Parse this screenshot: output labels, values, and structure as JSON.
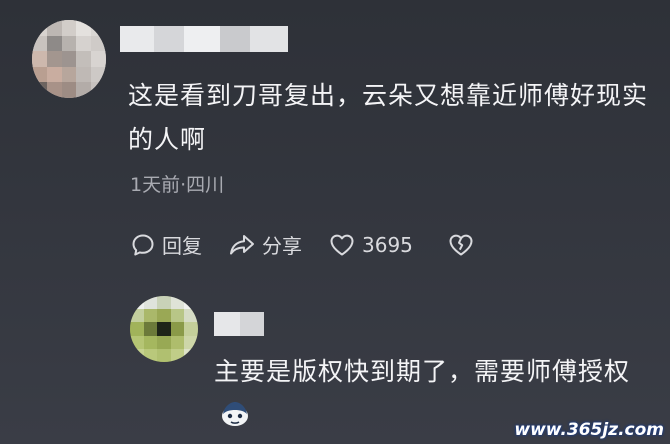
{
  "comment": {
    "text": "这是看到刀哥复出，云朵又想靠近师傅好现实的人啊",
    "meta": "1天前·四川",
    "actions": {
      "reply_label": "回复",
      "share_label": "分享",
      "like_count": "3695"
    }
  },
  "reply": {
    "text": "主要是版权快到期了，需要师傅授权"
  },
  "watermark": "www.365jz.com",
  "icons": [
    "comment-icon",
    "share-icon",
    "heart-icon",
    "dislike-heart-icon",
    "reply-emoji-icon"
  ]
}
